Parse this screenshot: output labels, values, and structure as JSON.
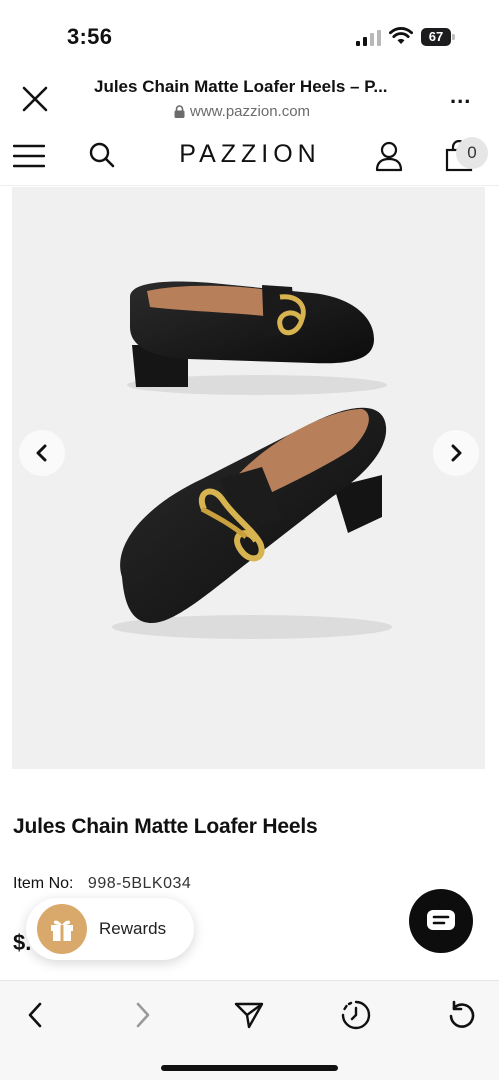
{
  "status_bar": {
    "time": "3:56",
    "battery": "67"
  },
  "browser": {
    "title": "Jules Chain Matte Loafer Heels – P...",
    "url": "www.pazzion.com",
    "more": "..."
  },
  "site_nav": {
    "logo": "PAZZION",
    "cart_count": "0"
  },
  "product": {
    "title": "Jules Chain Matte Loafer Heels",
    "item_label": "Item No:",
    "item_value": "998-5BLK034",
    "price": "$."
  },
  "rewards": {
    "label": "Rewards"
  },
  "colors": {
    "rewards_accent": "#d9a96b",
    "chat_button": "#0d0d0d",
    "image_background": "#f0f0f0"
  }
}
